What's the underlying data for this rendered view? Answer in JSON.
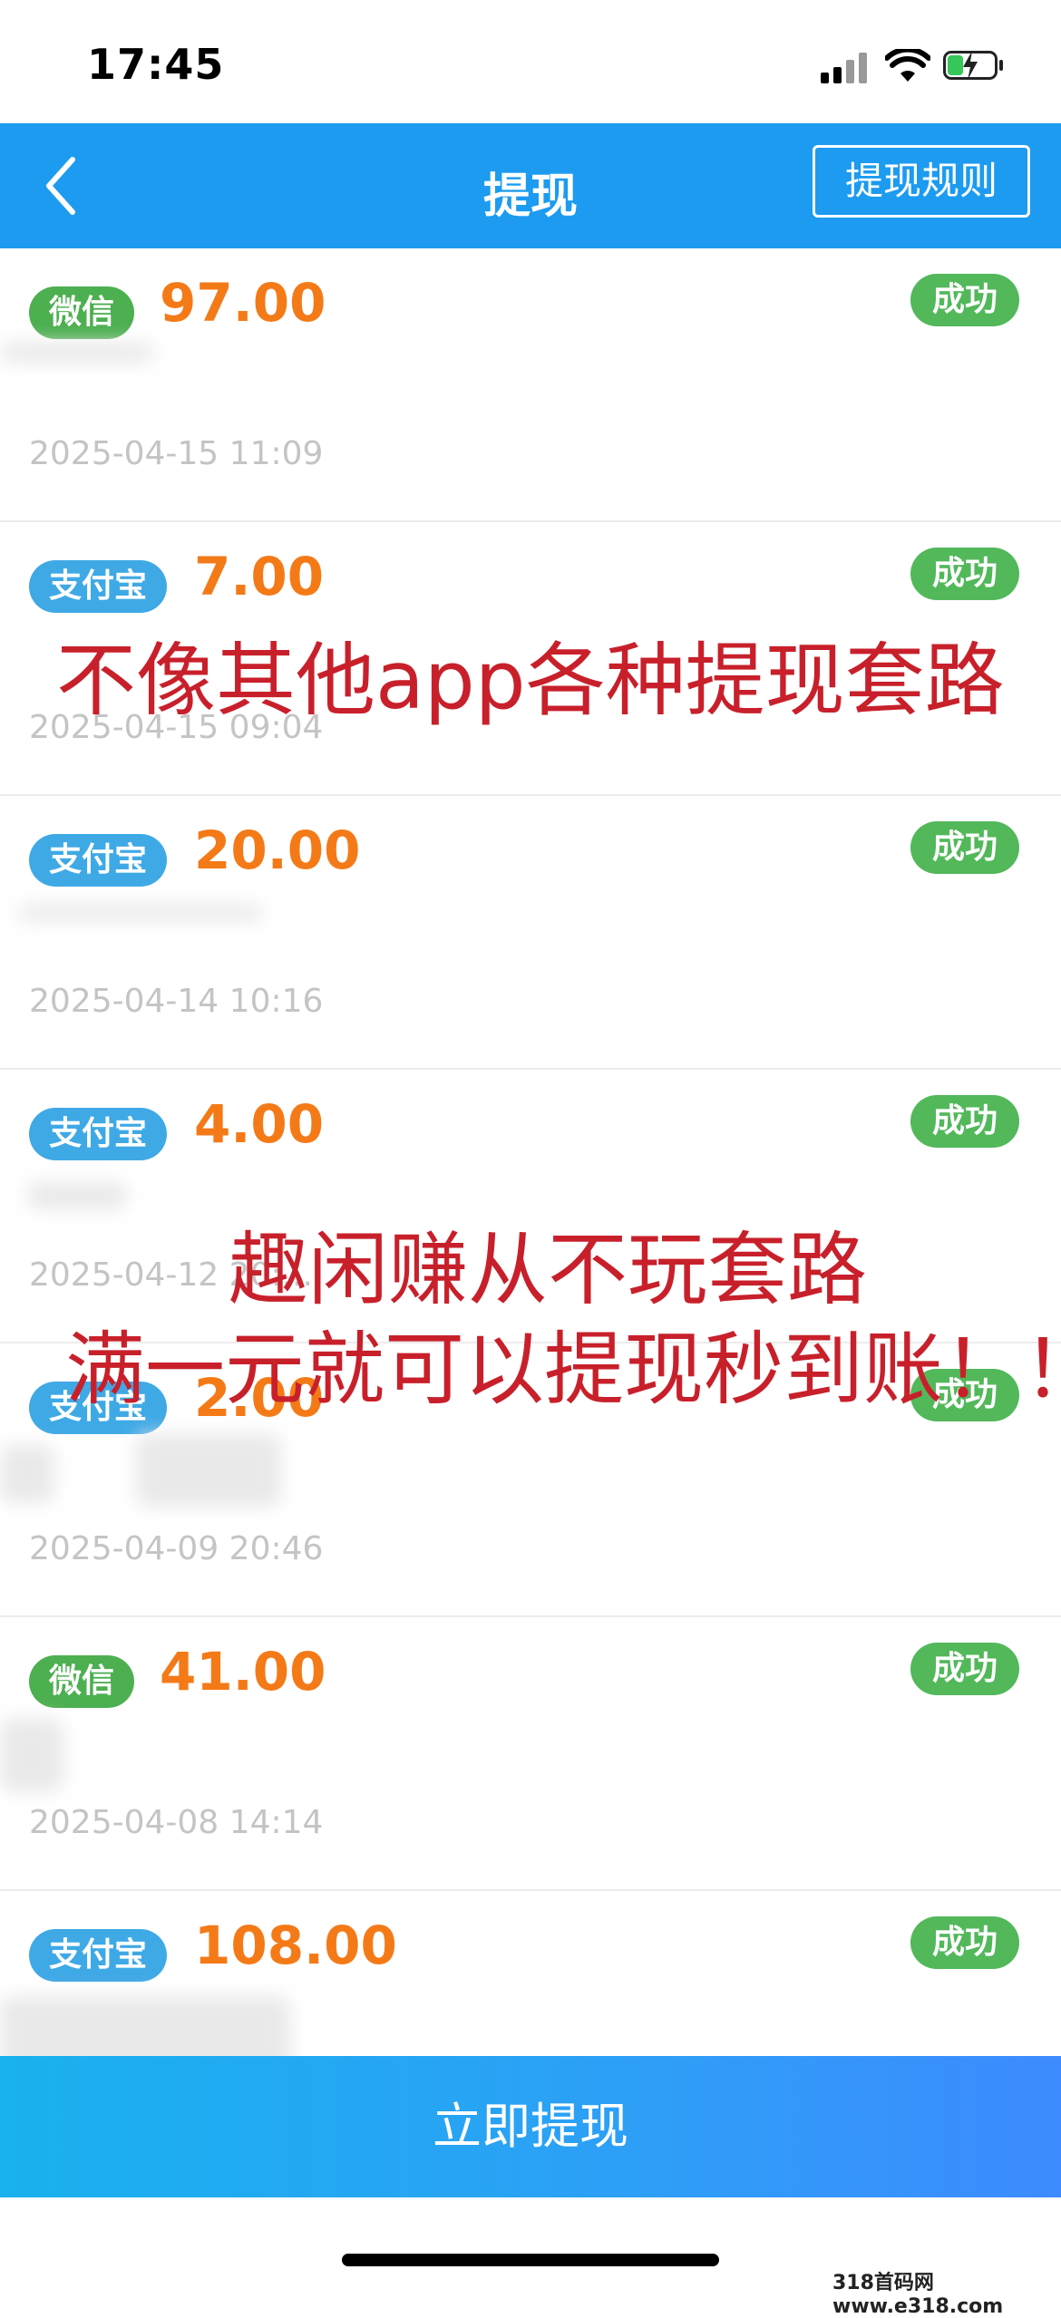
{
  "status_bar": {
    "time": "17:45"
  },
  "header": {
    "title": "提现",
    "rules_label": "提现规则"
  },
  "records": [
    {
      "method": "微信",
      "method_type": "wechat",
      "amount": "97.00",
      "status": "成功",
      "account": "",
      "time": "2025-04-15 11:09"
    },
    {
      "method": "支付宝",
      "method_type": "alipay",
      "amount": "7.00",
      "status": "成功",
      "account": "",
      "time": "2025-04-15 09:04"
    },
    {
      "method": "支付宝",
      "method_type": "alipay",
      "amount": "20.00",
      "status": "成功",
      "account": "",
      "time": "2025-04-14 10:16"
    },
    {
      "method": "支付宝",
      "method_type": "alipay",
      "amount": "4.00",
      "status": "成功",
      "account": "",
      "time": "2025-04-12 20:..."
    },
    {
      "method": "支付宝",
      "method_type": "alipay",
      "amount": "2.00",
      "status": "成功",
      "account": "",
      "time": "2025-04-09 20:46"
    },
    {
      "method": "微信",
      "method_type": "wechat",
      "amount": "41.00",
      "status": "成功",
      "account": "",
      "time": "2025-04-08 14:14"
    },
    {
      "method": "支付宝",
      "method_type": "alipay",
      "amount": "108.00",
      "status": "成功",
      "account": "",
      "time": ""
    }
  ],
  "overlay": {
    "line1": "不像其他app各种提现套路",
    "line2": "趣闲赚从不玩套路",
    "line3": "满一元就可以提现秒到账！！"
  },
  "footer": {
    "withdraw_label": "立即提现"
  },
  "watermark": "318首码网 www.e318.com",
  "colors": {
    "nav": "#1c9bf0",
    "amount": "#f47a18",
    "success": "#52b85a",
    "wechat": "#4caf50",
    "alipay": "#3fa9e6",
    "overlay_text": "#c8202b"
  }
}
